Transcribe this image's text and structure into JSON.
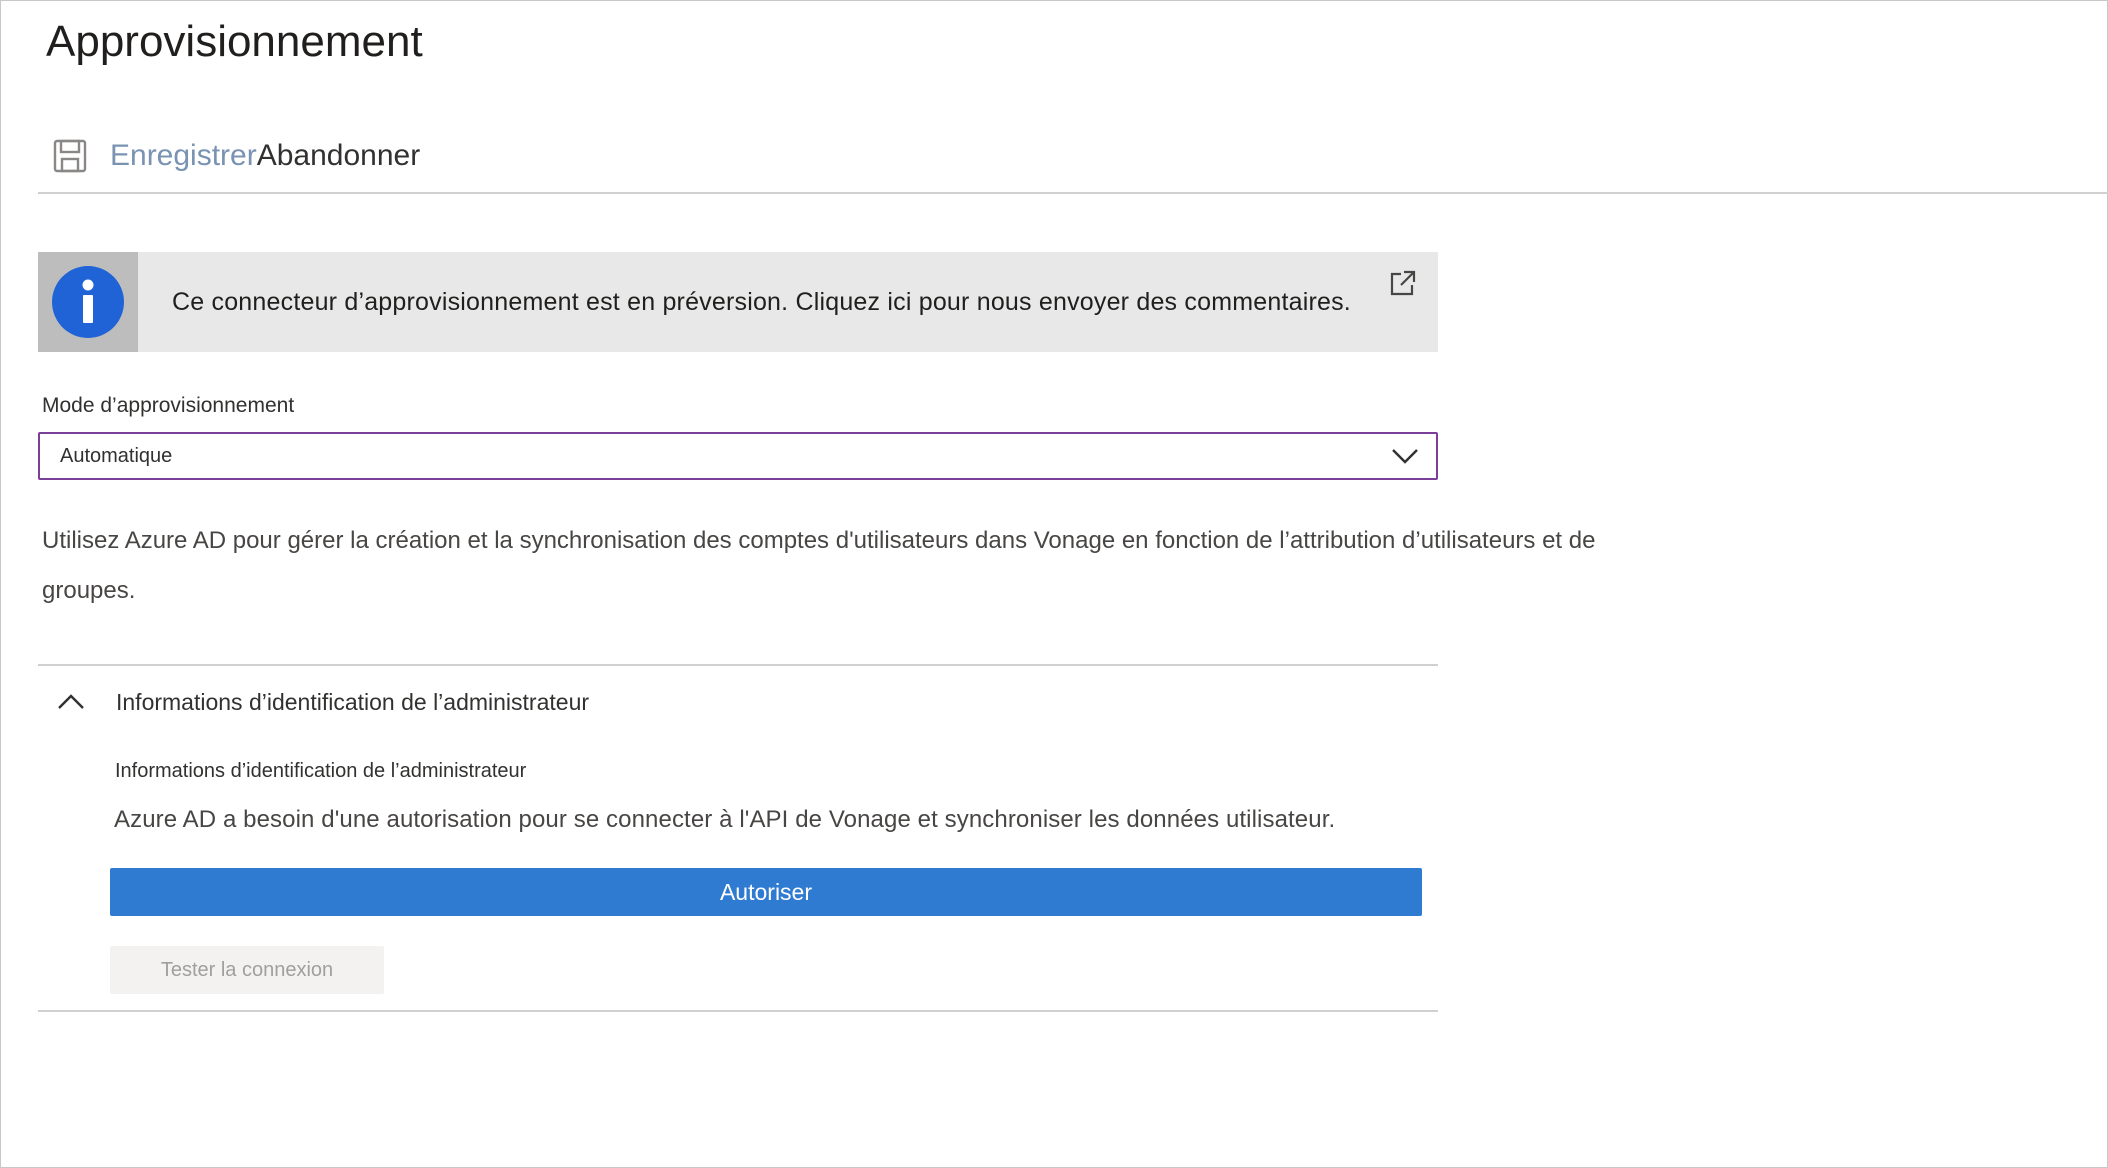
{
  "page": {
    "title": "Approvisionnement"
  },
  "toolbar": {
    "save_label": "Enregistrer",
    "discard_label": "Abandonner"
  },
  "banner": {
    "message": "Ce connecteur d’approvisionnement est en préversion. Cliquez ici pour nous envoyer des commentaires.",
    "icon": "info-icon",
    "link_icon": "external-link-icon"
  },
  "provisioning_mode": {
    "label": "Mode d’approvisionnement",
    "selected": "Automatique"
  },
  "description": "Utilisez Azure AD pour gérer la création et la synchronisation des comptes d'utilisateurs dans Vonage en fonction de l’attribution d’utilisateurs et de groupes.",
  "admin_credentials": {
    "section_title": "Informations d’identification de l’administrateur",
    "subsection_label": "Informations d’identification de l’administrateur",
    "help_text": "Azure AD a besoin d'une autorisation pour se connecter à l'API de Vonage et synchroniser les données utilisateur.",
    "authorize_label": "Autoriser",
    "test_label": "Tester la connexion"
  },
  "colors": {
    "accent_blue": "#2f7bd1",
    "focus_purple": "#7b3f98",
    "info_blue": "#1f63d6",
    "banner_bg": "#e8e8e8"
  }
}
